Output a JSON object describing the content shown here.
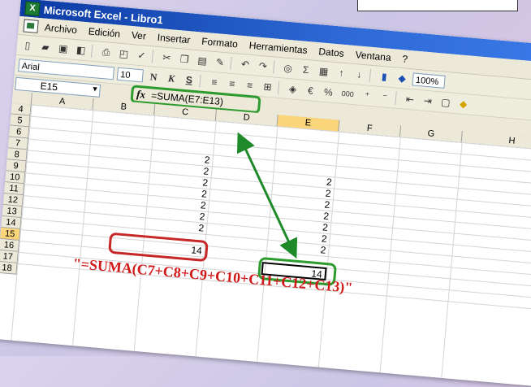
{
  "window": {
    "title": "Microsoft Excel - Libro1",
    "app_icon": "excel-icon"
  },
  "menu": {
    "items": [
      {
        "label": "Archivo",
        "accel": "A"
      },
      {
        "label": "Edición",
        "accel": "E"
      },
      {
        "label": "Ver",
        "accel": "V"
      },
      {
        "label": "Insertar",
        "accel": "I"
      },
      {
        "label": "Formato",
        "accel": "F"
      },
      {
        "label": "Herramientas",
        "accel": "H"
      },
      {
        "label": "Datos",
        "accel": "D"
      },
      {
        "label": "Ventana",
        "accel": "n"
      },
      {
        "label": "?",
        "accel": "?"
      }
    ]
  },
  "toolbar": {
    "font_name": "Arial",
    "font_size": "10",
    "bold_label": "N",
    "italic_label": "K",
    "underline_label": "S",
    "currency": "€",
    "percent": "%",
    "thousands": "000",
    "zoom": "100%"
  },
  "formula_bar": {
    "name_box": "E15",
    "fx": "fx",
    "formula": "=SUMA(E7:E13)"
  },
  "grid": {
    "columns": [
      "A",
      "B",
      "C",
      "D",
      "E",
      "F",
      "G",
      "H"
    ],
    "rows": [
      "4",
      "5",
      "6",
      "7",
      "8",
      "9",
      "10",
      "11",
      "12",
      "13",
      "14",
      "15",
      "16",
      "17",
      "18"
    ],
    "active_column": "E",
    "active_row": "15",
    "col_c_values": [
      "2",
      "2",
      "2",
      "2",
      "2",
      "2",
      "2"
    ],
    "col_e_values": [
      "2",
      "2",
      "2",
      "2",
      "2",
      "2",
      "2"
    ],
    "sum_c": "14",
    "sum_e": "14"
  },
  "annotation": {
    "long_formula": "\"=SUMA(C7+C8+C9+C10+C11+C12+C13)\"",
    "red_color": "#c62828",
    "green_color": "#2e9b2e"
  }
}
